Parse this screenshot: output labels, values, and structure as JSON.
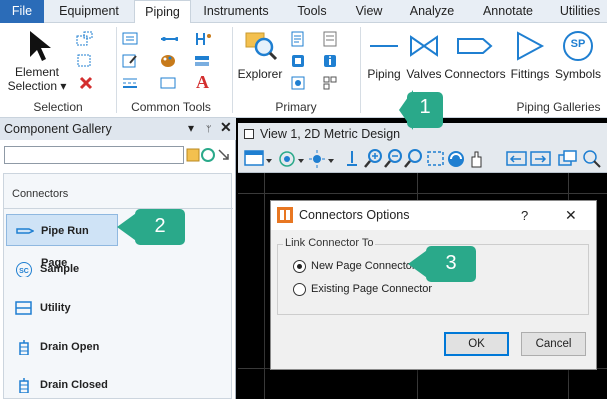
{
  "ribbon": {
    "tabs": [
      "File",
      "Equipment",
      "Piping",
      "Instruments",
      "Tools",
      "View",
      "Analyze",
      "Annotate",
      "Utilities"
    ],
    "active_tab": "Piping",
    "selection": {
      "element_selection_label": "Element\nSelection ▾",
      "group_label": "Selection"
    },
    "common_tools": {
      "group_label": "Common Tools"
    },
    "primary": {
      "explorer_label": "Explorer",
      "group_label": "Primary"
    },
    "piping_galleries": {
      "buttons": [
        "Piping",
        "Valves",
        "Connectors",
        "Fittings",
        "Symbols"
      ],
      "sp_icon_text": "SP",
      "group_label": "Piping Galleries"
    }
  },
  "component_gallery": {
    "title": "Component Gallery",
    "pin_glyph": "▾ ⊓ ✕",
    "section_label": "Connectors",
    "items": [
      "Pipe Run Page",
      "Sample",
      "Utility",
      "Drain Open",
      "Drain Closed"
    ],
    "selected": "Pipe Run Page",
    "icons": [
      "pipe-run-page-icon",
      "sample-icon",
      "utility-icon",
      "drain-open-icon",
      "drain-closed-icon"
    ]
  },
  "view": {
    "title": "View 1, 2D Metric Design"
  },
  "dialog": {
    "title": "Connectors Options",
    "help_glyph": "?",
    "close_glyph": "✕",
    "group_label": "Link Connector To",
    "options": [
      "New Page Connector",
      "Existing Page Connector"
    ],
    "selected_option": "New Page Connector",
    "ok_label": "OK",
    "cancel_label": "Cancel"
  },
  "callouts": [
    "1",
    "2",
    "3"
  ],
  "colors": {
    "accent": "#2b6cb8",
    "callout": "#2aa98a",
    "icon_blue": "#1f7fd1"
  }
}
